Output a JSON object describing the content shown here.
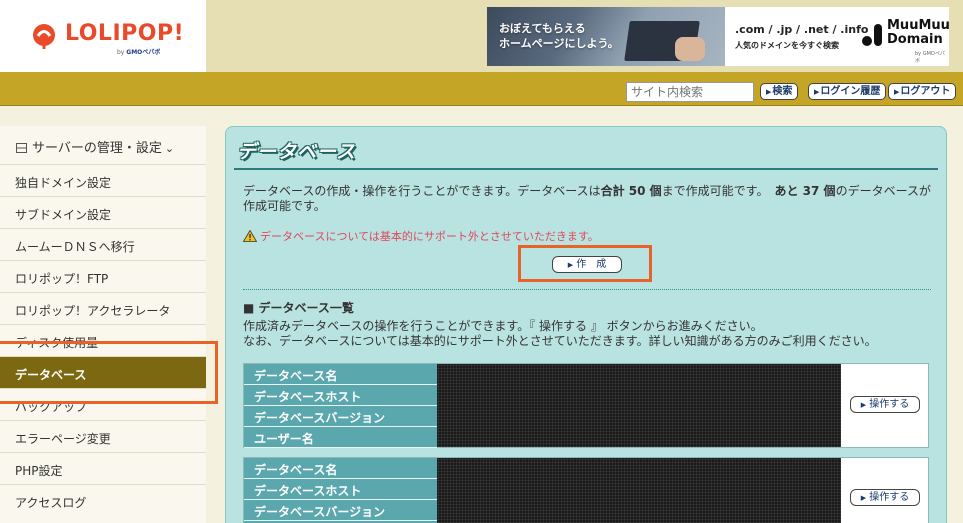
{
  "brand": {
    "logo_text": "LOLIPOP!",
    "logo_sub_prefix": "by",
    "logo_sub_company": "GMOペパボ"
  },
  "banner": {
    "message": "おぼえてもらえる\nホームページにしよう。",
    "domains": ".com / .jp / .net / .info",
    "tagline": "人気のドメインを今すぐ検索",
    "brand_line1": "MuuMuu",
    "brand_line2": "Domain",
    "brand_sub": "by GMOペパボ"
  },
  "nav": {
    "search_placeholder": "サイト内検索",
    "search_button": "検索",
    "login_history_button": "ログイン履歴",
    "logout_button": "ログアウト"
  },
  "sidebar": {
    "heading": "サーバーの管理・設定",
    "items": [
      {
        "label": "独自ドメイン設定"
      },
      {
        "label": "サブドメイン設定"
      },
      {
        "label": "ムームーＤＮＳへ移行"
      },
      {
        "label": "ロリポップ！FTP"
      },
      {
        "label": "ロリポップ！アクセラレータ"
      },
      {
        "label": "ディスク使用量"
      },
      {
        "label": "データベース"
      },
      {
        "label": "バックアップ"
      },
      {
        "label": "エラーページ変更"
      },
      {
        "label": "PHP設定"
      },
      {
        "label": "アクセスログ"
      }
    ]
  },
  "main": {
    "title": "データベース",
    "intro_part1": "データベースの作成・操作を行うことができます。データベースは",
    "intro_limit": "合計 50 個",
    "intro_part2": "まで作成可能です。",
    "intro_remaining": "あと 37 個",
    "intro_part3": "のデータベースが作成可能です。",
    "warning": "データベースについては基本的にサポート外とさせていただきます。",
    "create_button": "作　成",
    "list_title": "■ データベース一覧",
    "list_desc_line1": "作成済みデータベースの操作を行うことができます。『 操作する 』 ボタンからお進みください。",
    "list_desc_line2": "なお、データベースについては基本的にサポート外とさせていただきます。詳しい知識がある方のみご利用ください。",
    "db_fields": [
      "データベース名",
      "データベースホスト",
      "データベースバージョン",
      "ユーザー名"
    ],
    "operate_button": "操作する"
  },
  "colors": {
    "accent": "#c5a526",
    "sidebar_active": "#7d6812",
    "panel_bg": "#b9e3e1",
    "label_bg": "#5aa7ad",
    "highlight": "#e8622a",
    "warning_text": "#e0475a"
  }
}
